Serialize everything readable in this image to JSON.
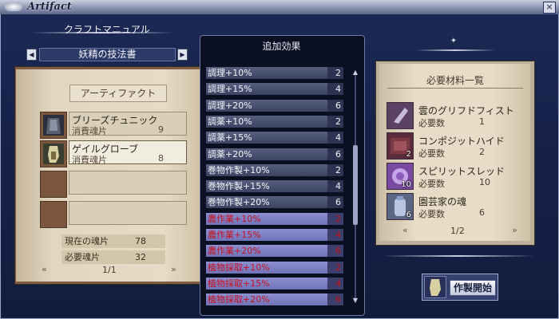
{
  "window": {
    "title": "Artifact",
    "close": "×"
  },
  "left": {
    "header": "クラフトマニュアル",
    "book_name": "妖精の技法書",
    "tab": "アーティファクト",
    "prev": "◀",
    "next": "▶",
    "items": [
      {
        "name": "ブリーズチュニック",
        "sub": "消費魂片",
        "value": "9",
        "icon": "tunic-icon"
      },
      {
        "name": "ゲイルグローブ",
        "sub": "消費魂片",
        "value": "8",
        "icon": "glove-icon"
      },
      {
        "name": "",
        "sub": "",
        "value": ""
      },
      {
        "name": "",
        "sub": "",
        "value": ""
      }
    ],
    "souls": [
      {
        "label": "現在の魂片",
        "value": "78"
      },
      {
        "label": "必要魂片",
        "value": "32"
      }
    ],
    "page": "1/1",
    "page_prev": "«",
    "page_next": "»"
  },
  "middle": {
    "header": "追加効果",
    "rows": [
      {
        "label": "調理+10%",
        "value": "2",
        "red": false
      },
      {
        "label": "調理+15%",
        "value": "4",
        "red": false
      },
      {
        "label": "調理+20%",
        "value": "6",
        "red": false
      },
      {
        "label": "調薬+10%",
        "value": "2",
        "red": false
      },
      {
        "label": "調薬+15%",
        "value": "4",
        "red": false
      },
      {
        "label": "調薬+20%",
        "value": "6",
        "red": false
      },
      {
        "label": "巻物作製+10%",
        "value": "2",
        "red": false
      },
      {
        "label": "巻物作製+15%",
        "value": "4",
        "red": false
      },
      {
        "label": "巻物作製+20%",
        "value": "6",
        "red": false
      },
      {
        "label": "農作業+10%",
        "value": "2",
        "red": true
      },
      {
        "label": "農作業+15%",
        "value": "4",
        "red": true
      },
      {
        "label": "農作業+20%",
        "value": "6",
        "red": true
      },
      {
        "label": "植物採取+10%",
        "value": "2",
        "red": true
      },
      {
        "label": "植物採取+15%",
        "value": "4",
        "red": true
      },
      {
        "label": "植物採取+20%",
        "value": "6",
        "red": true
      }
    ]
  },
  "right": {
    "title": "必要材料一覧",
    "materials": [
      {
        "name": "雲のグリフドフィスト",
        "req_label": "必要数",
        "req": "1",
        "count": "",
        "icon": "fist-icon"
      },
      {
        "name": "コンポジットハイド",
        "req_label": "必要数",
        "req": "2",
        "count": "2",
        "icon": "hide-icon"
      },
      {
        "name": "スピリットスレッド",
        "req_label": "必要数",
        "req": "10",
        "count": "10",
        "icon": "thread-icon"
      },
      {
        "name": "園芸家の魂",
        "req_label": "必要数",
        "req": "6",
        "count": "6",
        "icon": "soul-icon"
      }
    ],
    "page": "1/2",
    "page_prev": "«",
    "page_next": "»",
    "craft_button": "作製開始"
  }
}
